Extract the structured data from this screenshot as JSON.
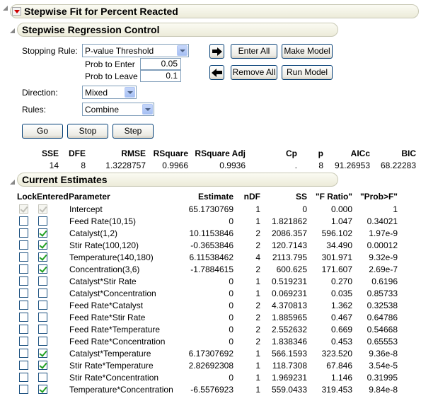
{
  "report": {
    "title": "Stepwise Fit for Percent Reacted"
  },
  "control": {
    "title": "Stepwise Regression Control",
    "stopping_rule_label": "Stopping Rule:",
    "stopping_rule_value": "P-value Threshold",
    "prob_enter_label": "Prob to Enter",
    "prob_enter_value": "0.05",
    "prob_leave_label": "Prob to Leave",
    "prob_leave_value": "0.1",
    "direction_label": "Direction:",
    "direction_value": "Mixed",
    "rules_label": "Rules:",
    "rules_value": "Combine",
    "enter_all": "Enter All",
    "make_model": "Make Model",
    "remove_all": "Remove All",
    "run_model": "Run Model",
    "go": "Go",
    "stop": "Stop",
    "step": "Step",
    "icons": {
      "enter": "arrow-right-icon",
      "remove": "arrow-left-icon"
    }
  },
  "stats": {
    "headers": [
      "SSE",
      "DFE",
      "RMSE",
      "RSquare",
      "RSquare Adj",
      "Cp",
      "p",
      "AICc",
      "BIC"
    ],
    "values": [
      "14",
      "8",
      "1.3228757",
      "0.9966",
      "0.9936",
      ".",
      "8",
      "91.26953",
      "68.22283"
    ]
  },
  "estimates": {
    "title": "Current Estimates",
    "headers": {
      "lock": "Lock",
      "entered": "Entered",
      "parameter": "Parameter",
      "estimate": "Estimate",
      "ndf": "nDF",
      "ss": "SS",
      "fratio": "\"F Ratio\"",
      "prob": "\"Prob>F\""
    },
    "rows": [
      {
        "lock": true,
        "entered": true,
        "disabled": true,
        "parameter": "Intercept",
        "estimate": "65.1730769",
        "ndf": "1",
        "ss": "0",
        "f": "0.000",
        "p": "1"
      },
      {
        "lock": false,
        "entered": false,
        "disabled": false,
        "parameter": "Feed Rate(10,15)",
        "estimate": "0",
        "ndf": "1",
        "ss": "1.821862",
        "f": "1.047",
        "p": "0.34021"
      },
      {
        "lock": false,
        "entered": true,
        "disabled": false,
        "parameter": "Catalyst(1,2)",
        "estimate": "10.1153846",
        "ndf": "2",
        "ss": "2086.357",
        "f": "596.102",
        "p": "1.97e-9"
      },
      {
        "lock": false,
        "entered": true,
        "disabled": false,
        "parameter": "Stir Rate(100,120)",
        "estimate": "-0.3653846",
        "ndf": "2",
        "ss": "120.7143",
        "f": "34.490",
        "p": "0.00012"
      },
      {
        "lock": false,
        "entered": true,
        "disabled": false,
        "parameter": "Temperature(140,180)",
        "estimate": "6.11538462",
        "ndf": "4",
        "ss": "2113.795",
        "f": "301.971",
        "p": "9.32e-9"
      },
      {
        "lock": false,
        "entered": true,
        "disabled": false,
        "parameter": "Concentration(3,6)",
        "estimate": "-1.7884615",
        "ndf": "2",
        "ss": "600.625",
        "f": "171.607",
        "p": "2.69e-7"
      },
      {
        "lock": false,
        "entered": false,
        "disabled": false,
        "parameter": "Catalyst*Stir Rate",
        "estimate": "0",
        "ndf": "1",
        "ss": "0.519231",
        "f": "0.270",
        "p": "0.6196"
      },
      {
        "lock": false,
        "entered": false,
        "disabled": false,
        "parameter": "Catalyst*Concentration",
        "estimate": "0",
        "ndf": "1",
        "ss": "0.069231",
        "f": "0.035",
        "p": "0.85733"
      },
      {
        "lock": false,
        "entered": false,
        "disabled": false,
        "parameter": "Feed Rate*Catalyst",
        "estimate": "0",
        "ndf": "2",
        "ss": "4.370813",
        "f": "1.362",
        "p": "0.32538"
      },
      {
        "lock": false,
        "entered": false,
        "disabled": false,
        "parameter": "Feed Rate*Stir Rate",
        "estimate": "0",
        "ndf": "2",
        "ss": "1.885965",
        "f": "0.467",
        "p": "0.64786"
      },
      {
        "lock": false,
        "entered": false,
        "disabled": false,
        "parameter": "Feed Rate*Temperature",
        "estimate": "0",
        "ndf": "2",
        "ss": "2.552632",
        "f": "0.669",
        "p": "0.54668"
      },
      {
        "lock": false,
        "entered": false,
        "disabled": false,
        "parameter": "Feed Rate*Concentration",
        "estimate": "0",
        "ndf": "2",
        "ss": "1.838346",
        "f": "0.453",
        "p": "0.65553"
      },
      {
        "lock": false,
        "entered": true,
        "disabled": false,
        "parameter": "Catalyst*Temperature",
        "estimate": "6.17307692",
        "ndf": "1",
        "ss": "566.1593",
        "f": "323.520",
        "p": "9.36e-8"
      },
      {
        "lock": false,
        "entered": true,
        "disabled": false,
        "parameter": "Stir Rate*Temperature",
        "estimate": "2.82692308",
        "ndf": "1",
        "ss": "118.7308",
        "f": "67.846",
        "p": "3.54e-5"
      },
      {
        "lock": false,
        "entered": false,
        "disabled": false,
        "parameter": "Stir Rate*Concentration",
        "estimate": "0",
        "ndf": "1",
        "ss": "1.969231",
        "f": "1.146",
        "p": "0.31995"
      },
      {
        "lock": false,
        "entered": true,
        "disabled": false,
        "parameter": "Temperature*Concentration",
        "estimate": "-6.5576923",
        "ndf": "1",
        "ss": "559.0433",
        "f": "319.453",
        "p": "9.84e-8"
      }
    ]
  }
}
